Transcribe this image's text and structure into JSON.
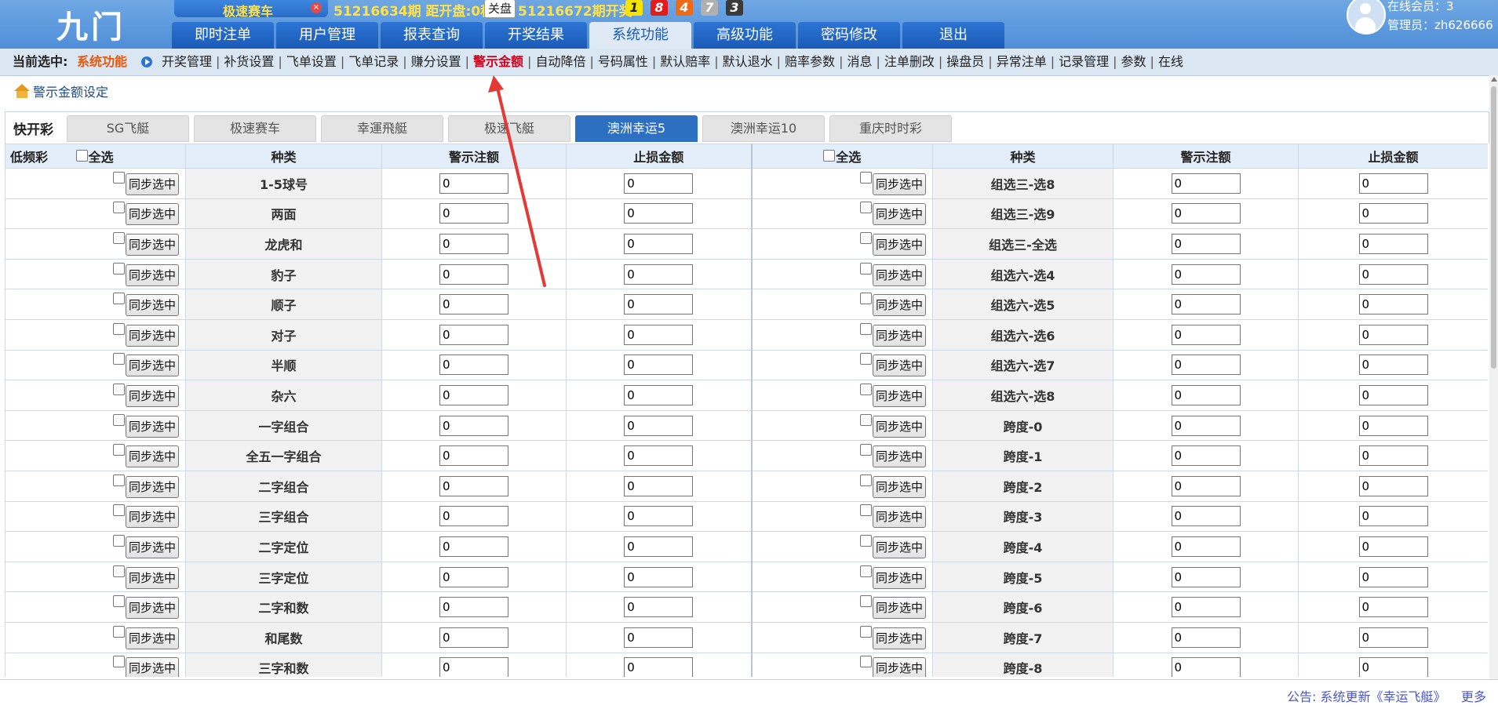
{
  "header": {
    "logo": "九门",
    "game_name": "极速赛车",
    "period_info": "51216634期  距开盘:0秒",
    "close_label": "关盘",
    "next_period": "51216672期开奖:",
    "balls": [
      {
        "value": "1",
        "bg": "#f5e400",
        "color": "#222"
      },
      {
        "value": "8",
        "bg": "#e31b1b",
        "color": "#fff"
      },
      {
        "value": "4",
        "bg": "#f06a14",
        "color": "#fff"
      },
      {
        "value": "7",
        "bg": "#b0b0b0",
        "color": "#fff"
      },
      {
        "value": "3",
        "bg": "#3a3a3a",
        "color": "#fff"
      }
    ],
    "online": "在线会员：3",
    "admin": "管理员：zh626666"
  },
  "nav": {
    "tabs": [
      "即时注单",
      "用户管理",
      "报表查询",
      "开奖结果",
      "系统功能",
      "高级功能",
      "密码修改",
      "退出"
    ],
    "active_index": 4
  },
  "subbar": {
    "current_label": "当前选中:",
    "current_value": "系统功能",
    "items": [
      "开奖管理",
      "补货设置",
      "飞单设置",
      "飞单记录",
      "赚分设置",
      "警示金额",
      "自动降倍",
      "号码属性",
      "默认赔率",
      "默认退水",
      "赔率参数",
      "消息",
      "注单删改",
      "操盘员",
      "异常注单",
      "记录管理",
      "参数",
      "在线"
    ],
    "active_index": 5
  },
  "breadcrumb": "警示金额设定",
  "lottery": {
    "label": "快开彩",
    "tabs": [
      "SG飞艇",
      "极速赛车",
      "幸運飛艇",
      "极速飞艇",
      "澳洲幸运5",
      "澳洲幸运10",
      "重庆时时彩"
    ],
    "active_index": 4
  },
  "table": {
    "low_freq_label": "低频彩",
    "select_all": "全选",
    "col_type": "种类",
    "col_warn": "警示注额",
    "col_stop": "止损金额",
    "sync_label": "同步选中",
    "left_types": [
      "1-5球号",
      "两面",
      "龙虎和",
      "豹子",
      "顺子",
      "对子",
      "半顺",
      "杂六",
      "一字组合",
      "全五一字组合",
      "二字组合",
      "三字组合",
      "二字定位",
      "三字定位",
      "二字和数",
      "和尾数",
      "三字和数"
    ],
    "right_types": [
      "组选三-选8",
      "组选三-选9",
      "组选三-全选",
      "组选六-选4",
      "组选六-选5",
      "组选六-选6",
      "组选六-选7",
      "组选六-选8",
      "跨度-0",
      "跨度-1",
      "跨度-2",
      "跨度-3",
      "跨度-4",
      "跨度-5",
      "跨度-6",
      "跨度-7",
      "跨度-8"
    ],
    "default_value": "0"
  },
  "footer": {
    "notice": "公告:  系统更新《幸运飞艇》",
    "more": "更多"
  },
  "colors": {
    "nav_bg": "#1b5bb8",
    "accent_orange": "#e8570c",
    "active_red": "#d0021b",
    "annotation": "#e53935"
  }
}
